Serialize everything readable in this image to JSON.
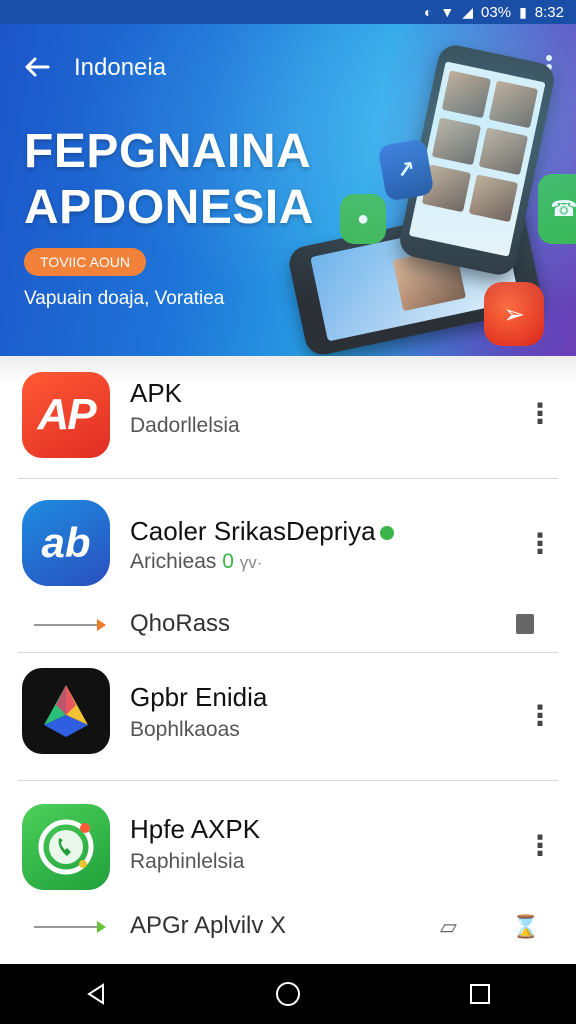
{
  "status_bar": {
    "icons": [
      "do-not-disturb-icon",
      "wifi-icon",
      "signal-icon",
      "battery-icon"
    ],
    "battery": "03%",
    "time": "8:32"
  },
  "header": {
    "title": "Indoneia"
  },
  "hero": {
    "headline": "FEPGNAINA\nAPDONESIA",
    "pill": "TOVIIC AOUN",
    "subtitle": "Vapuain doaja, Voratiea"
  },
  "apps": [
    {
      "title": "APK",
      "subtitle": "Dadorllelsia",
      "icon_text": "AP"
    },
    {
      "title": "Caoler SrikasDepriya",
      "subtitle": "Arichieas",
      "subtitle_extra": "0",
      "subtitle_tail": "γv·",
      "icon_text": "ab",
      "row": {
        "label": "QhoRass"
      }
    },
    {
      "title": "Gpbr Enidia",
      "subtitle": "Bophlkaoas"
    },
    {
      "title": "Hpfe AXPK",
      "subtitle": "Raphinlelsia",
      "row": {
        "label": "APGr Aplvilv X"
      }
    }
  ],
  "colors": {
    "accent_blue": "#1c56c9",
    "orange": "#f2813a",
    "green": "#3bb54a"
  }
}
